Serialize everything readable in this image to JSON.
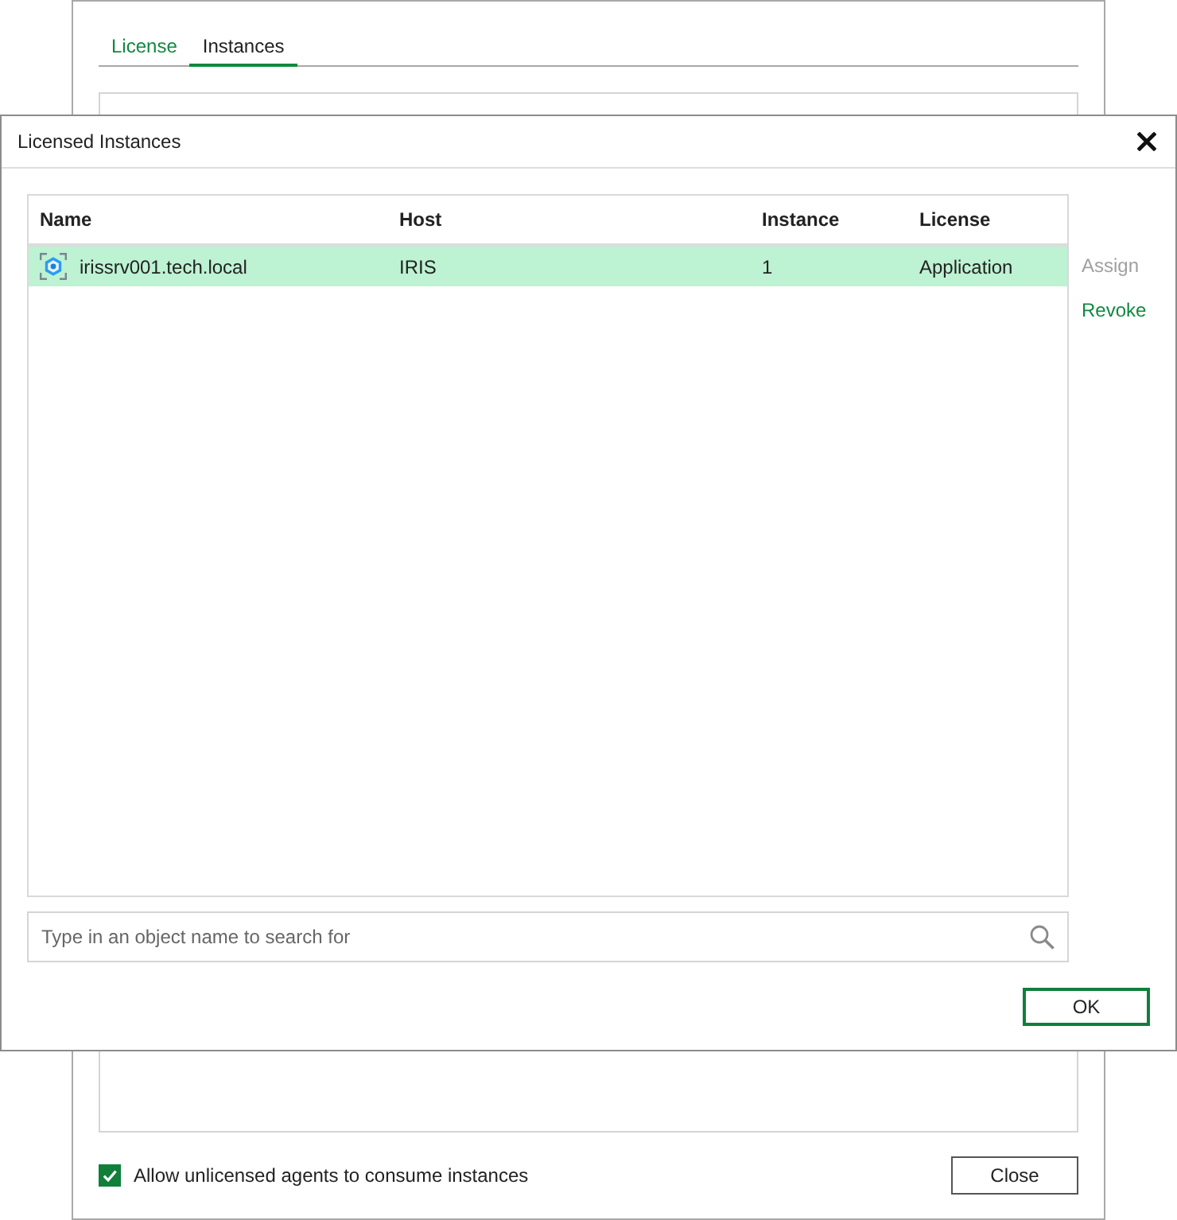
{
  "background_window": {
    "tabs": [
      {
        "label": "License",
        "selected": false
      },
      {
        "label": "Instances",
        "selected": true
      }
    ],
    "allow_unlicensed_agents": {
      "label": "Allow unlicensed agents to consume instances",
      "checked": true
    },
    "buttons": [
      {
        "label": "Close",
        "default": false
      }
    ]
  },
  "dialog": {
    "title": "Licensed Instances",
    "table": {
      "columns": [
        "Name",
        "Host",
        "Instance",
        "License"
      ],
      "rows": [
        {
          "name": "irissrv001.tech.local",
          "host": "IRIS",
          "instance": "1",
          "license": "Application",
          "selected": true
        }
      ]
    },
    "actions": [
      {
        "label": "Assign",
        "disabled": true
      },
      {
        "label": "Revoke",
        "disabled": false
      }
    ],
    "search": {
      "placeholder": "Type in an object name to search for"
    },
    "buttons": [
      {
        "label": "OK",
        "default": true
      }
    ]
  }
}
